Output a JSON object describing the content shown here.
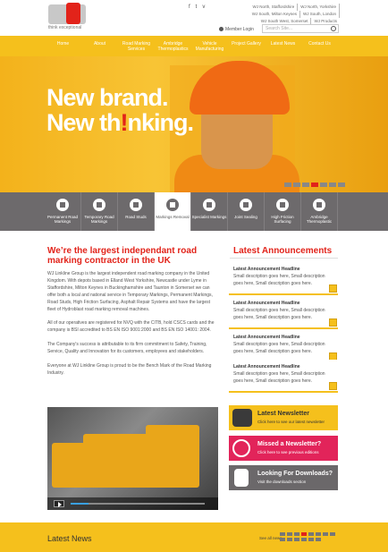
{
  "header": {
    "logo_text": "wj",
    "tagline": "think exceptional",
    "social": [
      "f",
      "t",
      "v"
    ],
    "locations": [
      "WJ North, Staffordshire",
      "WJ North, Yorkshire",
      "WJ South, Milton Keynes",
      "WJ South, London",
      "WJ South West, Somerset",
      "WJ Products"
    ],
    "member_login": "Member Login",
    "search_placeholder": "Search Site..."
  },
  "nav": [
    "Home",
    "About",
    "Road Marking Services",
    "Ambridge Thermoplastics",
    "Vehicle Manufacturing",
    "Project Gallery",
    "Latest News",
    "Contact Us"
  ],
  "hero": {
    "line1": "New brand.",
    "line2_a": "New th",
    "line2_ex": "!",
    "line2_b": "nking."
  },
  "services": [
    {
      "label": "Permanent Road Markings",
      "icon": "road-roller-icon"
    },
    {
      "label": "Temporary Road Markings",
      "icon": "machine-icon"
    },
    {
      "label": "Road Studs",
      "icon": "stud-icon"
    },
    {
      "label": "Markings Removal",
      "icon": "removal-icon",
      "active": true
    },
    {
      "label": "Specialist Markings",
      "icon": "van-icon"
    },
    {
      "label": "Joint Sealing",
      "icon": "sealer-icon"
    },
    {
      "label": "High Friction Surfacing",
      "icon": "truck-icon"
    },
    {
      "label": "Ambridge Thermoplastic",
      "icon": "barrel-icon"
    }
  ],
  "intro": {
    "title": "We’re the largest independant road marking contractor in the UK",
    "paragraphs": [
      "WJ Linkline Group is the largest independent road marking company in the United Kingdom. With depots based in Elland West Yorkshire, Newcastle under Lyme in Staffordshire, Milton Keynes in Buckinghamshire and Taunton in Somerset we can offer both a local and national service in Temporary Markings, Permanent Markings, Road Studs, High Friction Surfacing, Asphalt Repair Systems and  have the largest fleet of Hydroblast road marking removal machines.",
      "All of our operatives are registered for NVQ with the CITB, hold CSCS cards and the company is BSI accredited to BS EN ISO 9001:2000 and BS EN ISO 14001: 2004.",
      "The Company's success is attributable to its firm commitment to Safety, Training, Service, Quality and Innovation for its customers, employees and stakeholders.",
      "Everyone at WJ Linkline Group is proud to be the Bench Mark of the Road Marking Industry."
    ]
  },
  "announcements": {
    "title": "Latest Announcements",
    "items": [
      {
        "headline": "Latest Announcement Headline",
        "desc": "Small description goes here, Small description goes here, Small description goes here."
      },
      {
        "headline": "Latest Announcement Headline",
        "desc": "Small description goes here, Small description goes here, Small description goes here."
      },
      {
        "headline": "Latest Announcement Headline",
        "desc": "Small description goes here, Small description goes here, Small description goes here."
      },
      {
        "headline": "Latest Announcement Headline",
        "desc": "Small description goes here, Small description goes here, Small description goes here."
      }
    ]
  },
  "cta": [
    {
      "title": "Latest Newsletter",
      "sub": "Click here to see our latest newsletter",
      "icon": "book-icon"
    },
    {
      "title": "Missed a Newsletter?",
      "sub": "Click here to see previous editions",
      "icon": "history-icon"
    },
    {
      "title": "Looking For Downloads?",
      "sub": "Visit the downloads section",
      "icon": "document-icon"
    }
  ],
  "news": {
    "title": "Latest News",
    "see_all": "See all news"
  },
  "colors": {
    "accent_yellow": "#f5c01c",
    "accent_red": "#e2231a",
    "grey": "#6d6a6c"
  }
}
